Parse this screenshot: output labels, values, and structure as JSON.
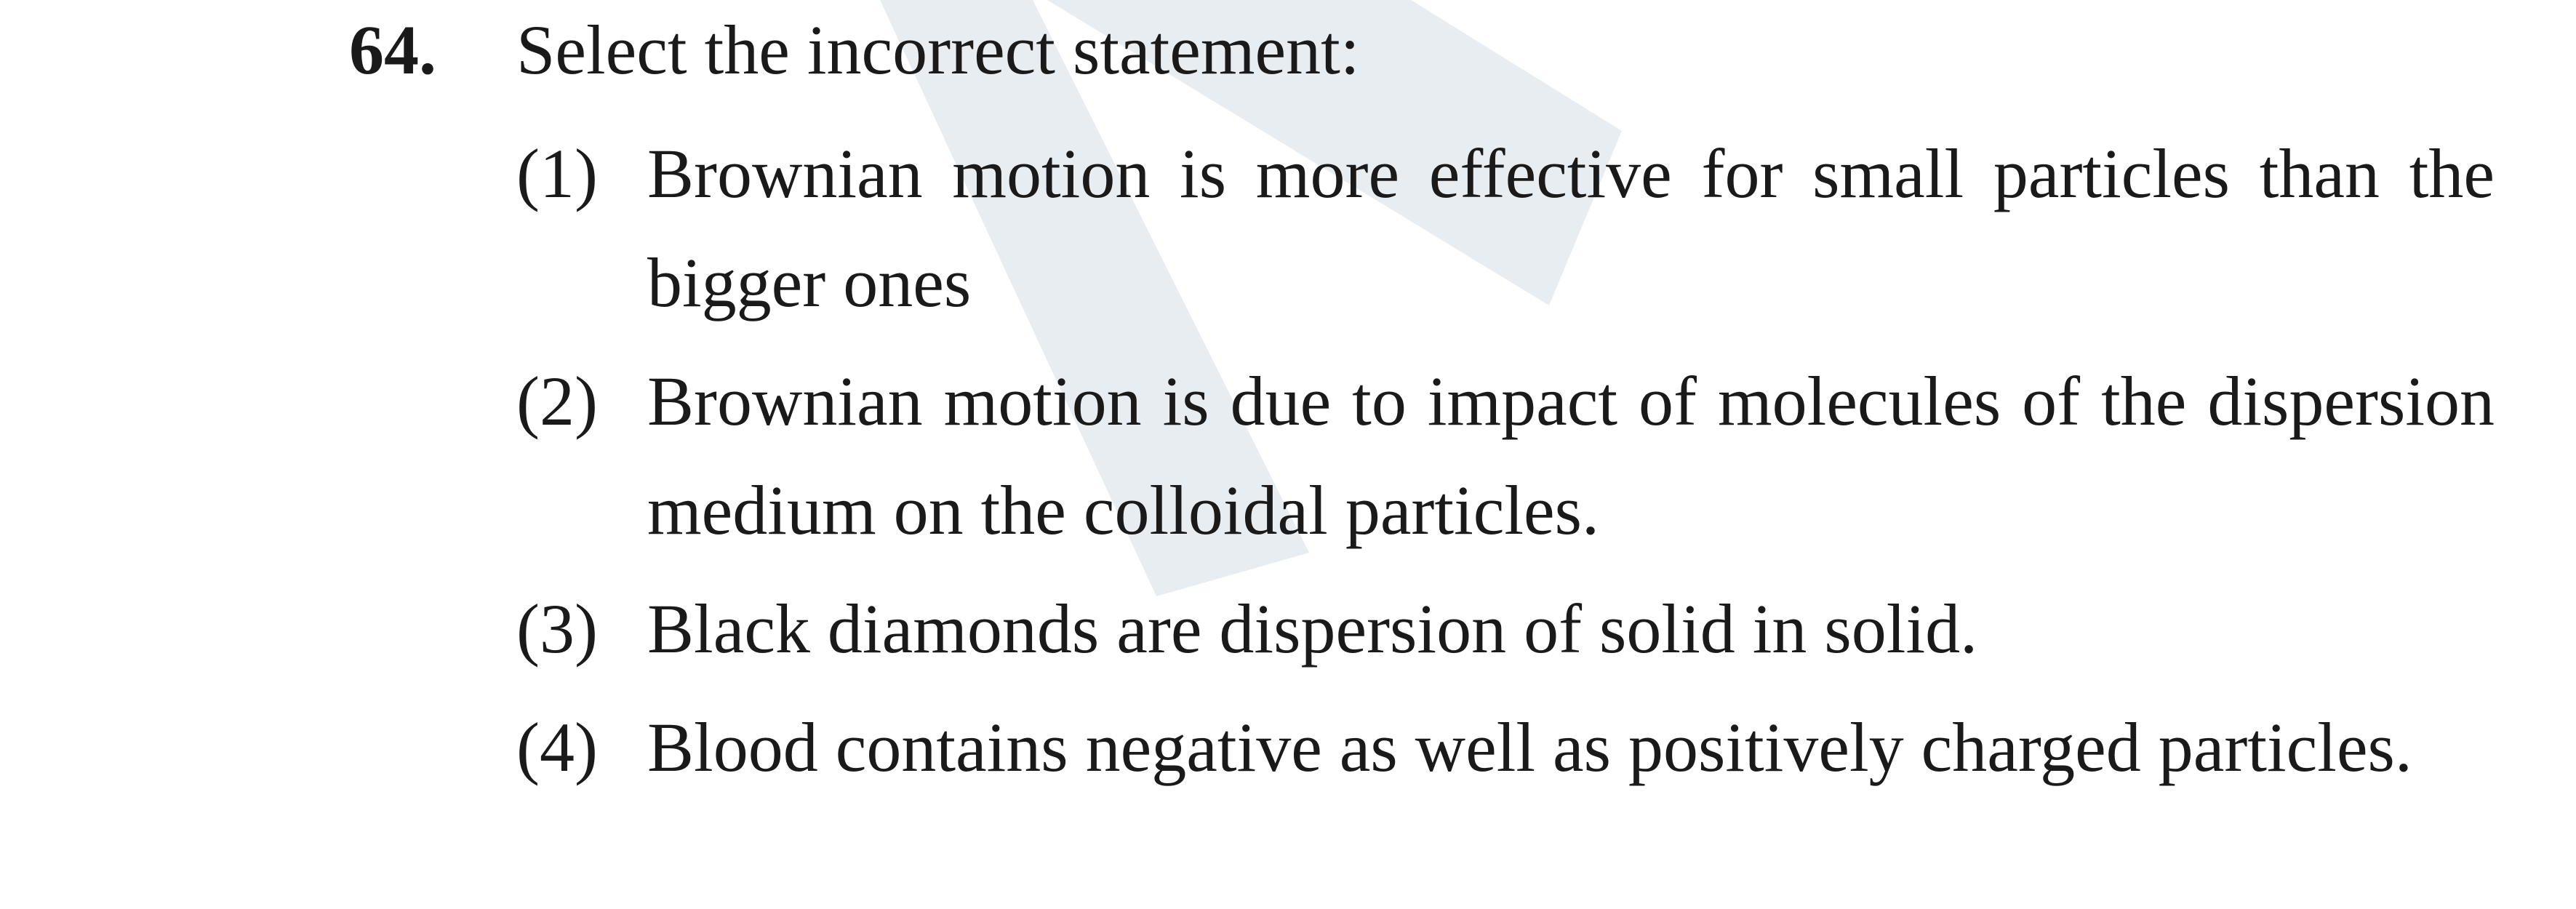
{
  "question": {
    "number": "64.",
    "prompt": "Select the incorrect statement:"
  },
  "options": [
    {
      "number": "(1)",
      "text": "Brownian motion is more effective for small particles than the bigger ones"
    },
    {
      "number": "(2)",
      "text": "Brownian motion is due to impact of molecules of the dispersion medium on the colloidal particles."
    },
    {
      "number": "(3)",
      "text": "Black diamonds are dispersion of solid in solid."
    },
    {
      "number": "(4)",
      "text": "Blood contains negative as well as positively charged particles."
    }
  ],
  "watermark": {
    "color": "#e8edf2"
  }
}
